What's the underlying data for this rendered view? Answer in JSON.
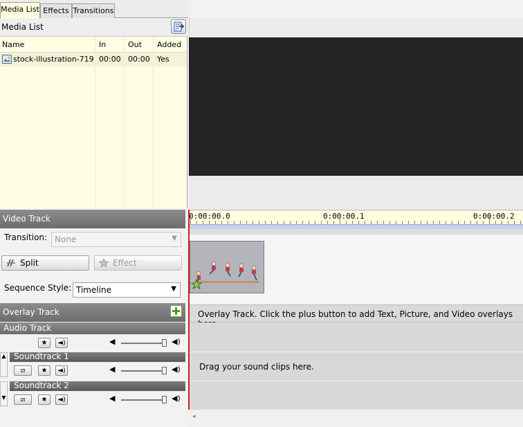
{
  "tabs": [
    "Media List",
    "Effects",
    "Transitions"
  ],
  "media_list": {
    "title": "Media List",
    "columns": [
      "Name",
      "In",
      "Out",
      "Added"
    ],
    "rows": [
      {
        "name": "stock-illustration-719...",
        "in": "00:00",
        "out": "00:00",
        "added": "Yes"
      }
    ]
  },
  "ruler": {
    "marks": [
      "0:00:00.0",
      "0:00:00.1",
      "0:00:00.2"
    ]
  },
  "video_track": {
    "title": "Video Track",
    "transition_label": "Transition:",
    "transition_value": "None",
    "split_label": "Split",
    "effect_label": "Effect",
    "sequence_label": "Sequence Style:",
    "sequence_value": "Timeline"
  },
  "overlay_track": {
    "title": "Overlay Track",
    "hint": "Overlay Track. Click the plus button to add Text, Picture, and Video overlays here."
  },
  "audio_track": {
    "title": "Audio Track",
    "hint": "Drag your sound clips here.",
    "soundtracks": [
      "Soundtrack 1",
      "Soundtrack 2"
    ],
    "volume_levels": [
      0.95,
      0.95,
      0.95
    ]
  },
  "icons": {
    "media_list_button": "media-export-icon",
    "split": "split-icon",
    "effect": "star-icon",
    "overlay_add": "plus-icon"
  },
  "colors": {
    "cursor": "#c8201c",
    "list_bg": "#fffde4",
    "preview_bg": "#232323"
  }
}
